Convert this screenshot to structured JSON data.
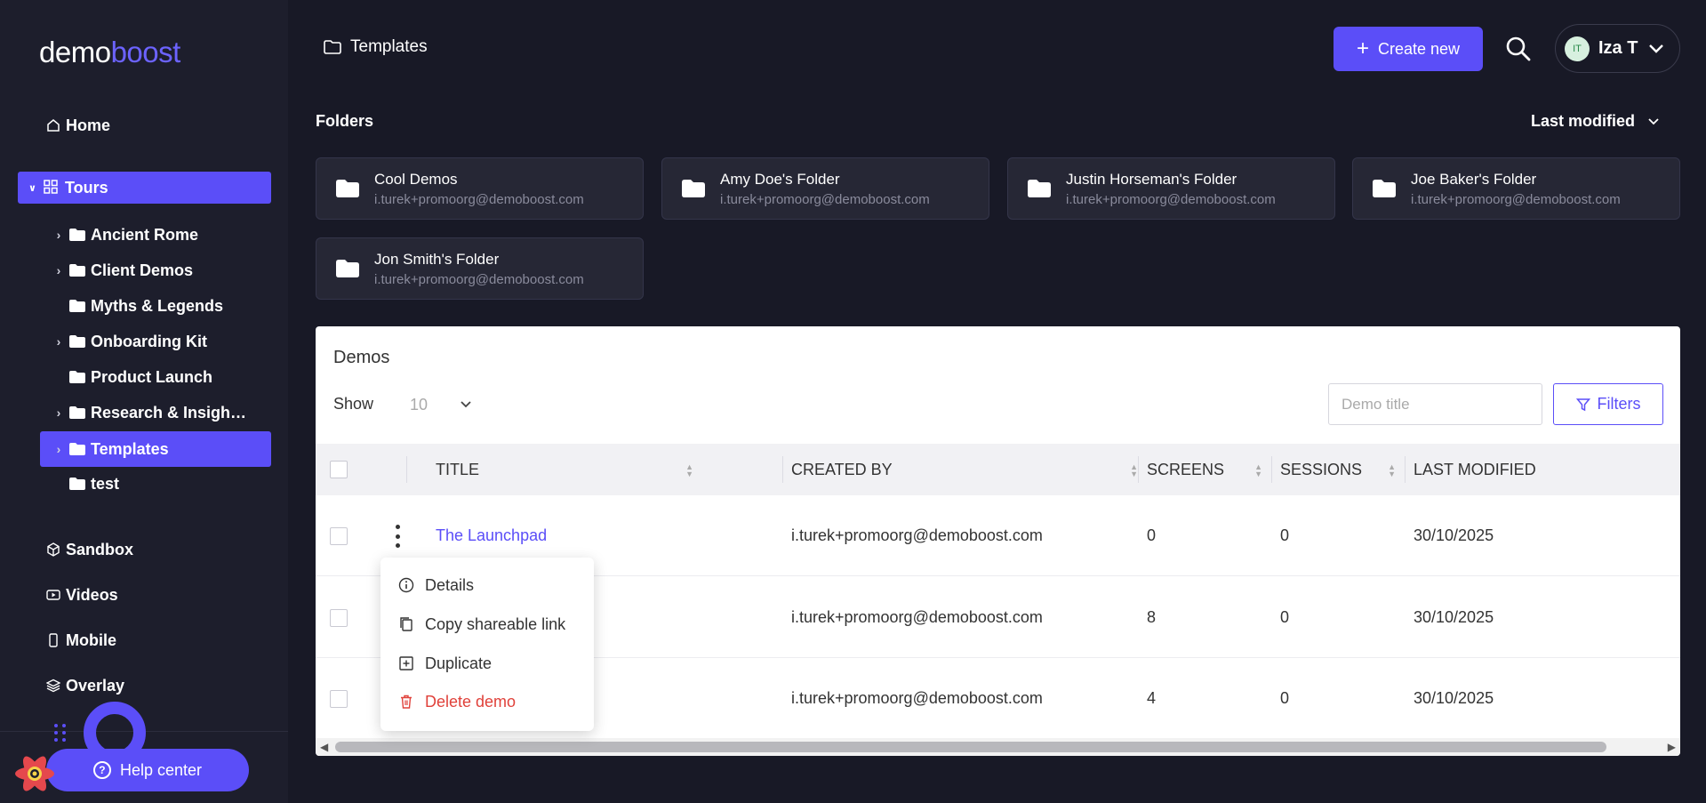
{
  "brand": {
    "part1": "demo",
    "part2": "boost"
  },
  "sidebar": {
    "nav_top": [
      {
        "label": "Home",
        "icon": "home-icon"
      }
    ],
    "tours": {
      "label": "Tours",
      "icon": "grid-icon"
    },
    "tree": [
      {
        "label": "Ancient Rome",
        "expandable": true
      },
      {
        "label": "Client Demos",
        "expandable": true
      },
      {
        "label": "Myths & Legends",
        "expandable": false
      },
      {
        "label": "Onboarding Kit",
        "expandable": true
      },
      {
        "label": "Product Launch",
        "expandable": false
      },
      {
        "label": "Research & Insigh…",
        "expandable": true
      },
      {
        "label": "Templates",
        "expandable": true,
        "active": true
      },
      {
        "label": "test",
        "expandable": false
      }
    ],
    "nav_bottom": [
      {
        "label": "Sandbox",
        "icon": "cube-icon"
      },
      {
        "label": "Videos",
        "icon": "video-icon"
      },
      {
        "label": "Mobile",
        "icon": "mobile-icon"
      },
      {
        "label": "Overlay",
        "icon": "layers-icon"
      }
    ],
    "help_label": "Help center"
  },
  "header": {
    "breadcrumb": "Templates",
    "create_label": "Create new",
    "user": {
      "initials": "IT",
      "name": "Iza T"
    }
  },
  "folders": {
    "title": "Folders",
    "sort_label": "Last modified",
    "items": [
      {
        "name": "Cool Demos",
        "owner": "i.turek+promoorg@demoboost.com"
      },
      {
        "name": "Amy Doe's Folder",
        "owner": "i.turek+promoorg@demoboost.com"
      },
      {
        "name": "Justin Horseman's Folder",
        "owner": "i.turek+promoorg@demoboost.com"
      },
      {
        "name": "Joe Baker's Folder",
        "owner": "i.turek+promoorg@demoboost.com"
      },
      {
        "name": "Jon Smith's Folder",
        "owner": "i.turek+promoorg@demoboost.com"
      }
    ]
  },
  "demos": {
    "title": "Demos",
    "show_label": "Show",
    "show_value": "10",
    "search_placeholder": "Demo title",
    "filters_label": "Filters",
    "columns": [
      "TITLE",
      "CREATED BY",
      "SCREENS",
      "SESSIONS",
      "LAST MODIFIED"
    ],
    "rows": [
      {
        "title": "The Launchpad",
        "created_by": "i.turek+promoorg@demoboost.com",
        "screens": "0",
        "sessions": "0",
        "last_modified": "30/10/2025"
      },
      {
        "title": "",
        "created_by": "i.turek+promoorg@demoboost.com",
        "screens": "8",
        "sessions": "0",
        "last_modified": "30/10/2025"
      },
      {
        "title": "",
        "created_by": "i.turek+promoorg@demoboost.com",
        "screens": "4",
        "sessions": "0",
        "last_modified": "30/10/2025"
      }
    ]
  },
  "context_menu": {
    "items": [
      {
        "label": "Details",
        "icon": "info-icon"
      },
      {
        "label": "Copy shareable link",
        "icon": "copy-icon"
      },
      {
        "label": "Duplicate",
        "icon": "duplicate-icon"
      },
      {
        "label": "Delete demo",
        "icon": "trash-icon",
        "danger": true
      }
    ]
  },
  "colors": {
    "accent": "#5b4ef8",
    "background": "#181926",
    "sidebar": "#1d1e2c",
    "danger": "#e0413a"
  }
}
